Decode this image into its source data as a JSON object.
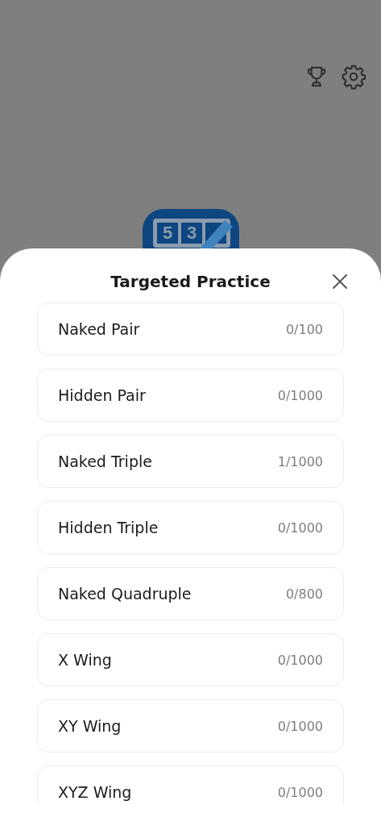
{
  "background": {
    "app_icon_digits": [
      "5",
      "3"
    ]
  },
  "sheet": {
    "title": "Targeted Practice",
    "items": [
      {
        "label": "Naked Pair",
        "progress": "0/100"
      },
      {
        "label": "Hidden Pair",
        "progress": "0/1000"
      },
      {
        "label": "Naked Triple",
        "progress": "1/1000"
      },
      {
        "label": "Hidden Triple",
        "progress": "0/1000"
      },
      {
        "label": "Naked Quadruple",
        "progress": "0/800"
      },
      {
        "label": "X Wing",
        "progress": "0/1000"
      },
      {
        "label": "XY Wing",
        "progress": "0/1000"
      },
      {
        "label": "XYZ Wing",
        "progress": "0/1000"
      }
    ]
  }
}
